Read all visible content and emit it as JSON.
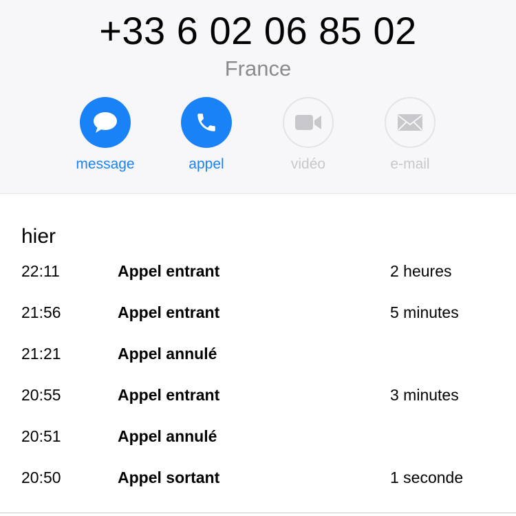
{
  "contact": {
    "phone_number": "+33 6 02 06 85 02",
    "country": "France"
  },
  "actions": [
    {
      "label": "message",
      "icon": "message-bubble-icon",
      "enabled": true
    },
    {
      "label": "appel",
      "icon": "phone-icon",
      "enabled": true
    },
    {
      "label": "vidéo",
      "icon": "video-camera-icon",
      "enabled": false
    },
    {
      "label": "e-mail",
      "icon": "envelope-icon",
      "enabled": false
    }
  ],
  "colors": {
    "accent": "#1a82f7",
    "disabled": "#c7c7cc",
    "header_bg": "#f7f7fa"
  },
  "history": {
    "section_title": "hier",
    "calls": [
      {
        "time": "22:11",
        "type": "Appel entrant",
        "duration": "2 heures"
      },
      {
        "time": "21:56",
        "type": "Appel entrant",
        "duration": "5 minutes"
      },
      {
        "time": "21:21",
        "type": "Appel annulé",
        "duration": ""
      },
      {
        "time": "20:55",
        "type": "Appel entrant",
        "duration": "3 minutes"
      },
      {
        "time": "20:51",
        "type": "Appel annulé",
        "duration": ""
      },
      {
        "time": "20:50",
        "type": "Appel sortant",
        "duration": "1 seconde"
      }
    ]
  }
}
